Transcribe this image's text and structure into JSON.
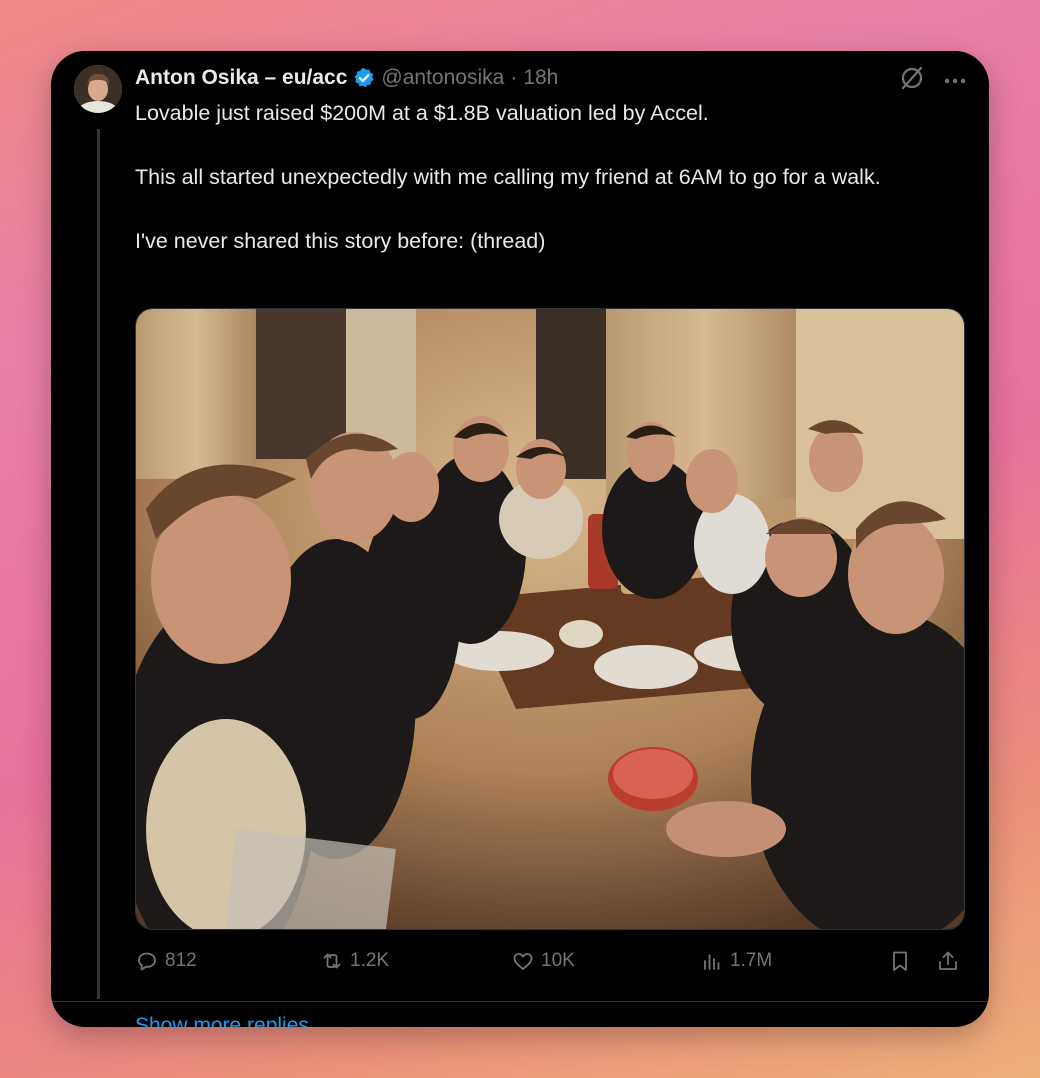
{
  "post": {
    "author_name": "Anton Osika – eu/acc",
    "handle": "@antonosika",
    "separator": "·",
    "time": "18h",
    "text": "Lovable just raised $200M at a $1.8B valuation led by Accel.\n\nThis all started unexpectedly with me calling my friend at 6AM to go for a walk.\n\nI've never shared this story before: (thread)",
    "icons": {
      "verified": "verified-badge-icon",
      "grok": "grok-icon",
      "more": "more-icon"
    }
  },
  "actions": {
    "replies": "812",
    "reposts": "1.2K",
    "likes": "10K",
    "views": "1.7M"
  },
  "footer": {
    "show_more": "Show more replies"
  },
  "colors": {
    "background": "#000000",
    "text": "#e7e9ea",
    "muted": "#71767b",
    "accent": "#1d9bf0"
  }
}
